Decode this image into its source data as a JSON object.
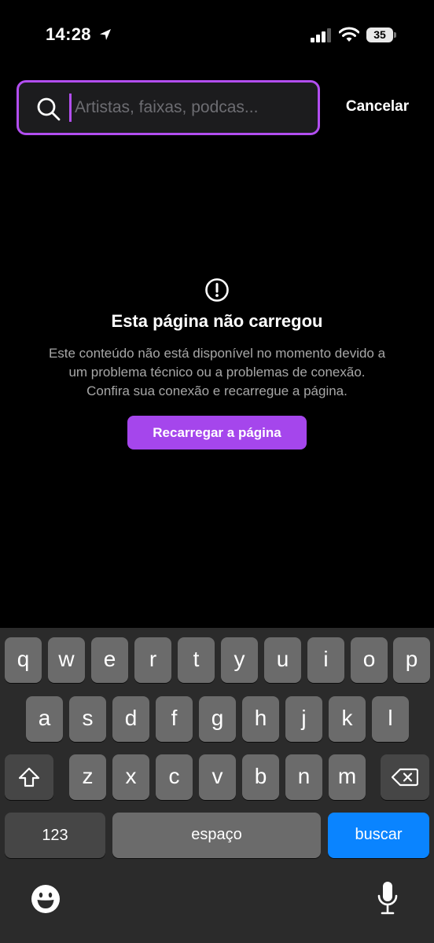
{
  "status_bar": {
    "time": "14:28",
    "battery_level": "35"
  },
  "search": {
    "placeholder": "Artistas, faixas, podcas...",
    "value": "",
    "cancel_label": "Cancelar"
  },
  "error": {
    "icon": "exclamation-circle-icon",
    "title": "Esta página não carregou",
    "message_line1": "Este conteúdo não está disponível no momento devido a",
    "message_line2": "um problema técnico ou a problemas de conexão.",
    "message_line3": "Confira sua conexão e recarregue a página.",
    "reload_label": "Recarregar a página"
  },
  "colors": {
    "accent": "#a546ec",
    "background": "#000000",
    "keyboard_background": "#2b2b2b",
    "search_key": "#0a84ff"
  },
  "keyboard": {
    "row1": [
      "q",
      "w",
      "e",
      "r",
      "t",
      "y",
      "u",
      "i",
      "o",
      "p"
    ],
    "row2": [
      "a",
      "s",
      "d",
      "f",
      "g",
      "h",
      "j",
      "k",
      "l"
    ],
    "row3": [
      "z",
      "x",
      "c",
      "v",
      "b",
      "n",
      "m"
    ],
    "numbers_label": "123",
    "space_label": "espaço",
    "action_label": "buscar"
  }
}
